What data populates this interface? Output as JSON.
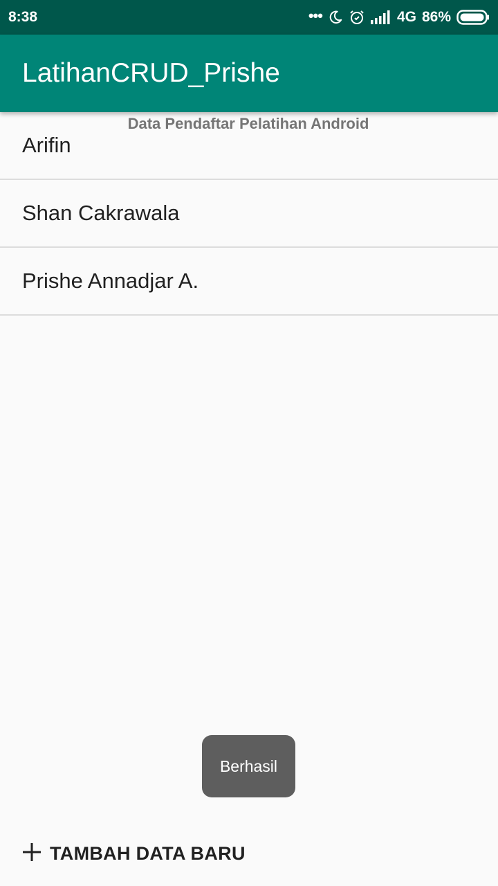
{
  "status_bar": {
    "time": "8:38",
    "dots": "•••",
    "network": "4G",
    "battery": "86%",
    "icons": [
      "moon-icon",
      "alarm-icon",
      "signal-icon",
      "battery-icon"
    ]
  },
  "app_bar": {
    "title": "LatihanCRUD_Prishe",
    "color": "#008577"
  },
  "list": {
    "header": "Data Pendaftar Pelatihan Android",
    "items": [
      {
        "label": "Arifin"
      },
      {
        "label": "Shan Cakrawala"
      },
      {
        "label": "Prishe Annadjar A."
      }
    ]
  },
  "toast": {
    "message": "Berhasil"
  },
  "add_button": {
    "icon": "plus-icon",
    "label": "TAMBAH DATA BARU"
  }
}
